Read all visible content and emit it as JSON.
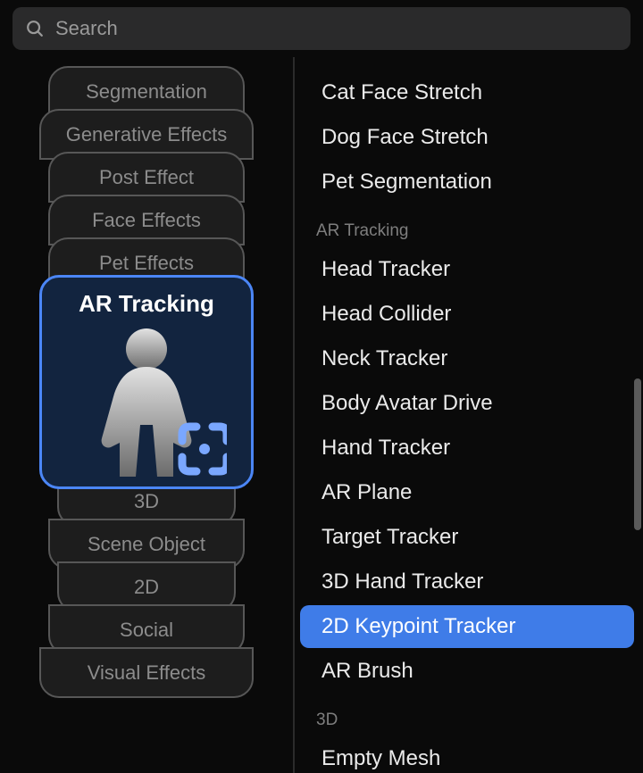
{
  "search": {
    "placeholder": "Search"
  },
  "left": {
    "stack_above": [
      "Segmentation",
      "Generative Effects",
      "Post Effect",
      "Face Effects",
      "Pet Effects"
    ],
    "selected": "AR Tracking",
    "stack_below": [
      "3D",
      "Scene Object",
      "2D",
      "Social",
      "Visual Effects"
    ]
  },
  "right": {
    "group0_items": [
      "Cat Face Stretch",
      "Dog Face Stretch",
      "Pet Segmentation"
    ],
    "group1_header": "AR Tracking",
    "group1_items": [
      "Head Tracker",
      "Head Collider",
      "Neck Tracker",
      "Body Avatar Drive",
      "Hand Tracker",
      "AR Plane",
      "Target Tracker",
      "3D Hand Tracker",
      "2D Keypoint Tracker",
      "AR Brush"
    ],
    "group1_selected_index": 8,
    "group2_header": "3D",
    "group2_items": [
      "Empty Mesh"
    ]
  },
  "colors": {
    "accent": "#3f7ce8",
    "card_selected_border": "#4b86f6",
    "card_selected_bg": "#12243f"
  }
}
